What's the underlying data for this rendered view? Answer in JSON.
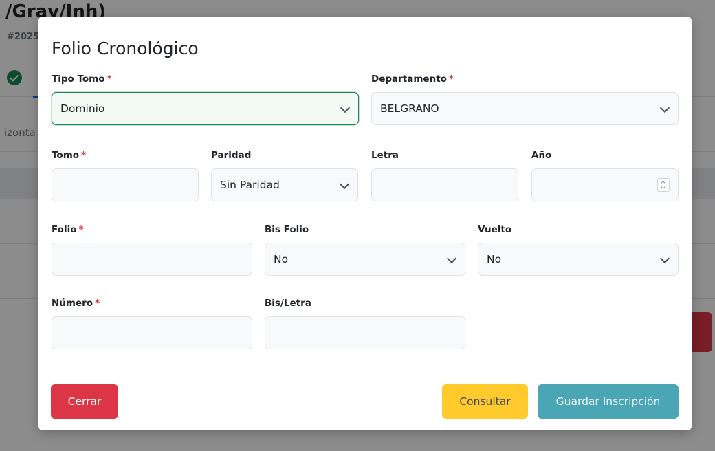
{
  "background": {
    "title": "/Grav/Inh)",
    "subtitle": "#2025",
    "partial_text": "izonta"
  },
  "modal": {
    "title": "Folio Cronológico",
    "required_mark": "*",
    "fields": {
      "tipo_tomo": {
        "label": "Tipo Tomo",
        "value": "Dominio"
      },
      "departamento": {
        "label": "Departamento",
        "value": "BELGRANO"
      },
      "tomo": {
        "label": "Tomo",
        "value": ""
      },
      "paridad": {
        "label": "Paridad",
        "value": "Sin Paridad"
      },
      "letra": {
        "label": "Letra",
        "value": ""
      },
      "anio": {
        "label": "Año",
        "value": ""
      },
      "folio": {
        "label": "Folio",
        "value": ""
      },
      "bis_folio": {
        "label": "Bis Folio",
        "value": "No"
      },
      "vuelto": {
        "label": "Vuelto",
        "value": "No"
      },
      "numero": {
        "label": "Número",
        "value": ""
      },
      "bis_letra": {
        "label": "Bis/Letra",
        "value": ""
      }
    },
    "buttons": {
      "close": "Cerrar",
      "consult": "Consultar",
      "save": "Guardar Inscripción"
    }
  },
  "colors": {
    "danger": "#dc3545",
    "warning": "#ffc107",
    "info": "#4aa6b5",
    "success": "#198754"
  },
  "icons": [
    "chevron-down-icon",
    "check-circle-icon",
    "spinner-arrows-icon"
  ]
}
